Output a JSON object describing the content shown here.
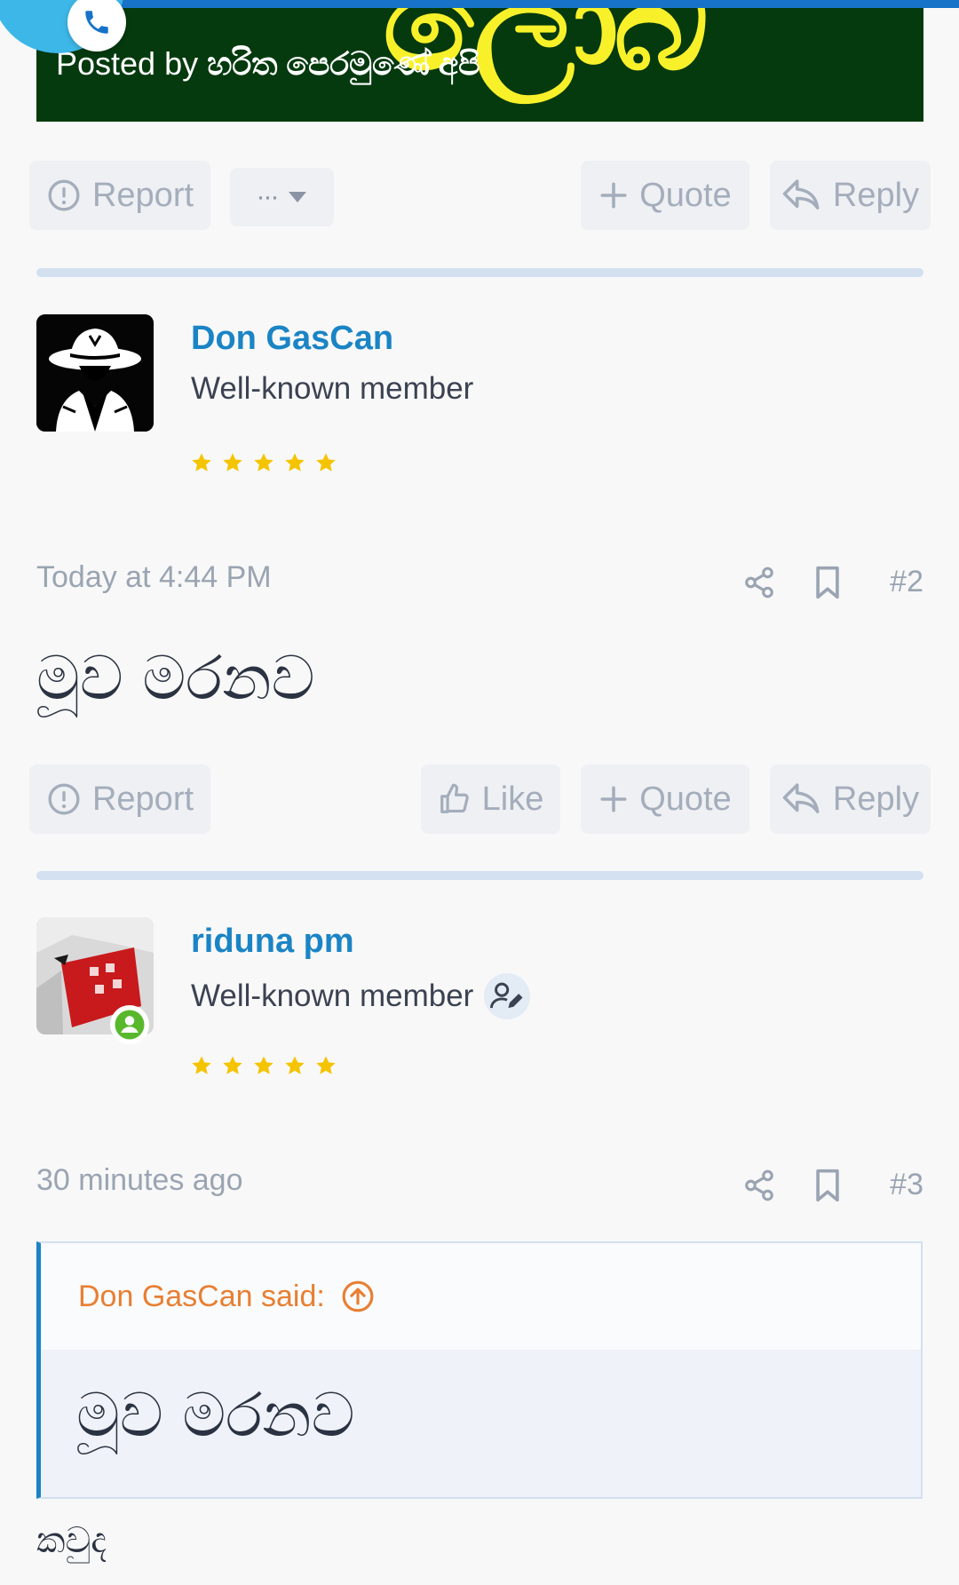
{
  "banner": {
    "posted_label": "Posted by",
    "posted_author": "හරිත පෙරමුණේ අපි",
    "art_text": "ලොබ"
  },
  "post1_actions": {
    "report": "Report",
    "more": "···",
    "quote": "Quote",
    "reply": "Reply"
  },
  "post2": {
    "username": "Don GasCan",
    "user_title": "Well-known member",
    "stars": 5,
    "time": "Today at 4:44 PM",
    "number": "#2",
    "message": "මූව මරනව",
    "actions": {
      "report": "Report",
      "like": "Like",
      "quote": "Quote",
      "reply": "Reply"
    }
  },
  "post3": {
    "username": "riduna pm",
    "user_title": "Well-known member",
    "stars": 5,
    "time": "30 minutes ago",
    "number": "#3",
    "quote_author": "Don GasCan said:",
    "quote_text": "මූව මරනව",
    "message": "කවුද"
  },
  "colors": {
    "accent": "#1a84c5",
    "quote_author": "#e87f32",
    "star": "#f5c400",
    "banner_bg": "#053a0e",
    "online": "#58b82b"
  }
}
